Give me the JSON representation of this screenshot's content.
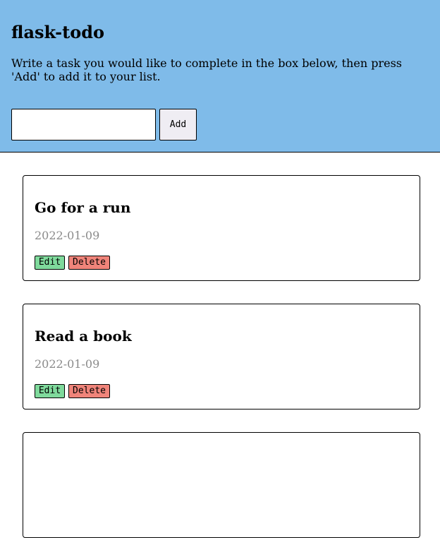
{
  "header": {
    "title": "flask-todo",
    "instructions": "Write a task you would like to complete in the box below, then press 'Add' to add it to your list.",
    "input_value": "",
    "add_label": "Add"
  },
  "tasks": [
    {
      "title": "Go for a run",
      "date": "2022-01-09",
      "edit_label": "Edit",
      "delete_label": "Delete"
    },
    {
      "title": "Read a book",
      "date": "2022-01-09",
      "edit_label": "Edit",
      "delete_label": "Delete"
    }
  ],
  "colors": {
    "header_bg": "#7fbbe9",
    "edit_bg": "#7fda9c",
    "delete_bg": "#f0847a",
    "date_text": "#8a8a8a"
  }
}
